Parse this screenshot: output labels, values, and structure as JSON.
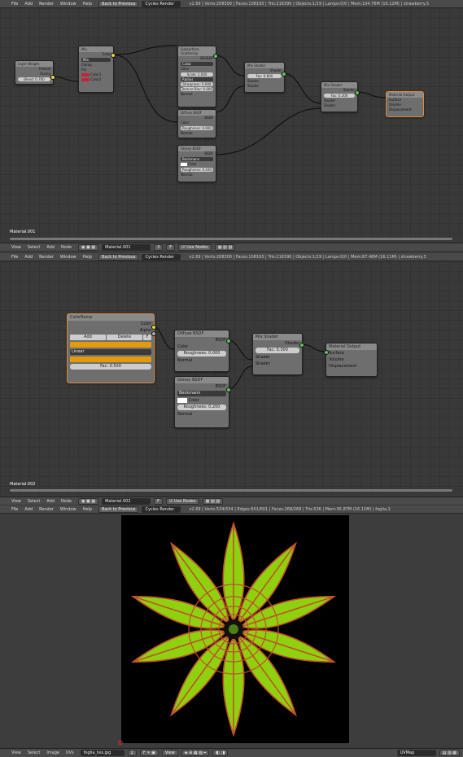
{
  "menus": [
    "File",
    "Add",
    "Render",
    "Window",
    "Help"
  ],
  "back_label": "Back to Previous",
  "engine": "Cycles Render",
  "info_top": "v2.69 | Verts:208300 | Faces:108193 | Tris:216390 | Objects:1/19 | Lamps:0/0 | Mem:104.76M (16.12M) | strawberry.3",
  "info_mid": "v2.69 | Verts:208300 | Faces:108193 | Tris:216390 | Objects:1/19 | Lamps:0/0 | Mem:87.48M (16.11M) | strawberry.3",
  "info_bot": "v2.69 | Verts:534/534 | Edges:601/601 | Faces:268/268 | Tris:536 | Mem:95.87M (16.11M) | foglia.2",
  "node_header_menus": [
    "View",
    "Select",
    "Add",
    "Node"
  ],
  "image_header_menus": [
    "View",
    "Select",
    "Image",
    "UVs"
  ],
  "use_nodes": "Use Nodes",
  "editor1": {
    "material": "Material.001",
    "users": "3",
    "layer_weight": {
      "title": "Layer Weight",
      "out1": "Fresnel",
      "out2": "Facing",
      "blend": "Blend: 0.700"
    },
    "mix": {
      "title": "Mix",
      "out": "Color",
      "type": "Mix",
      "clamp": "Clamp",
      "fac": "Fac",
      "c1": "Color1",
      "c2": "Color2"
    },
    "sss": {
      "title": "Subsurface Scattering",
      "out": "BSSRDF",
      "mode": "Cubic",
      "color": "Color",
      "scale": "Scale: 1.000",
      "radius": "Radius",
      "sharp": "Sharpness: 0.000",
      "tex": "Texture Blur: 0.000",
      "normal": "Normal"
    },
    "diffuse": {
      "title": "Diffuse BSDF",
      "out": "BSDF",
      "color": "Color",
      "rough": "Roughness: 0.000",
      "normal": "Normal"
    },
    "glossy": {
      "title": "Glossy BSDF",
      "out": "BSDF",
      "dist": "Beckmann",
      "color": "Color",
      "rough": "Roughness: 0.100",
      "normal": "Normal"
    },
    "mix1": {
      "title": "Mix Shader",
      "out": "Shader",
      "fac": "Fac: 0.800",
      "s1": "Shader",
      "s2": "Shader"
    },
    "mix2": {
      "title": "Mix Shader",
      "out": "Shader",
      "fac": "Fac: 0.200",
      "s1": "Shader",
      "s2": "Shader"
    },
    "output": {
      "title": "Material Output",
      "surface": "Surface",
      "volume": "Volume",
      "disp": "Displacement"
    }
  },
  "editor2": {
    "material": "Material.002",
    "ramp": {
      "title": "ColorRamp",
      "out1": "Color",
      "out2": "Alpha",
      "add": "Add",
      "del": "Delete",
      "f": "F",
      "interp": "Linear",
      "fac": "Fac: 0.500"
    },
    "diffuse": {
      "title": "Diffuse BSDF",
      "out": "BSDF",
      "color": "Color",
      "rough": "Roughness: 0.000",
      "normal": "Normal"
    },
    "glossy": {
      "title": "Glossy BSDF",
      "out": "BSDF",
      "dist": "Beckmann",
      "color": "Color",
      "rough": "Roughness: 0.200",
      "normal": "Normal"
    },
    "mix": {
      "title": "Mix Shader",
      "out": "Shader",
      "fac": "Fac: 0.300",
      "s1": "Shader",
      "s2": "Shader"
    },
    "output": {
      "title": "Material Output",
      "surface": "Surface",
      "volume": "Volume",
      "disp": "Displacement"
    }
  },
  "image_editor": {
    "image": "foglia_tex.jpg",
    "users": "2",
    "view": "View",
    "uvmap": "UVMap"
  },
  "colors": {
    "ramp_left": "#f0a500",
    "ramp_right": "#d98b00",
    "leaf": "#8fd10f",
    "edge": "#c0502a",
    "sock_color": "#e5d93b",
    "sock_shader": "#62c362",
    "sock_vector": "#6363c7"
  }
}
